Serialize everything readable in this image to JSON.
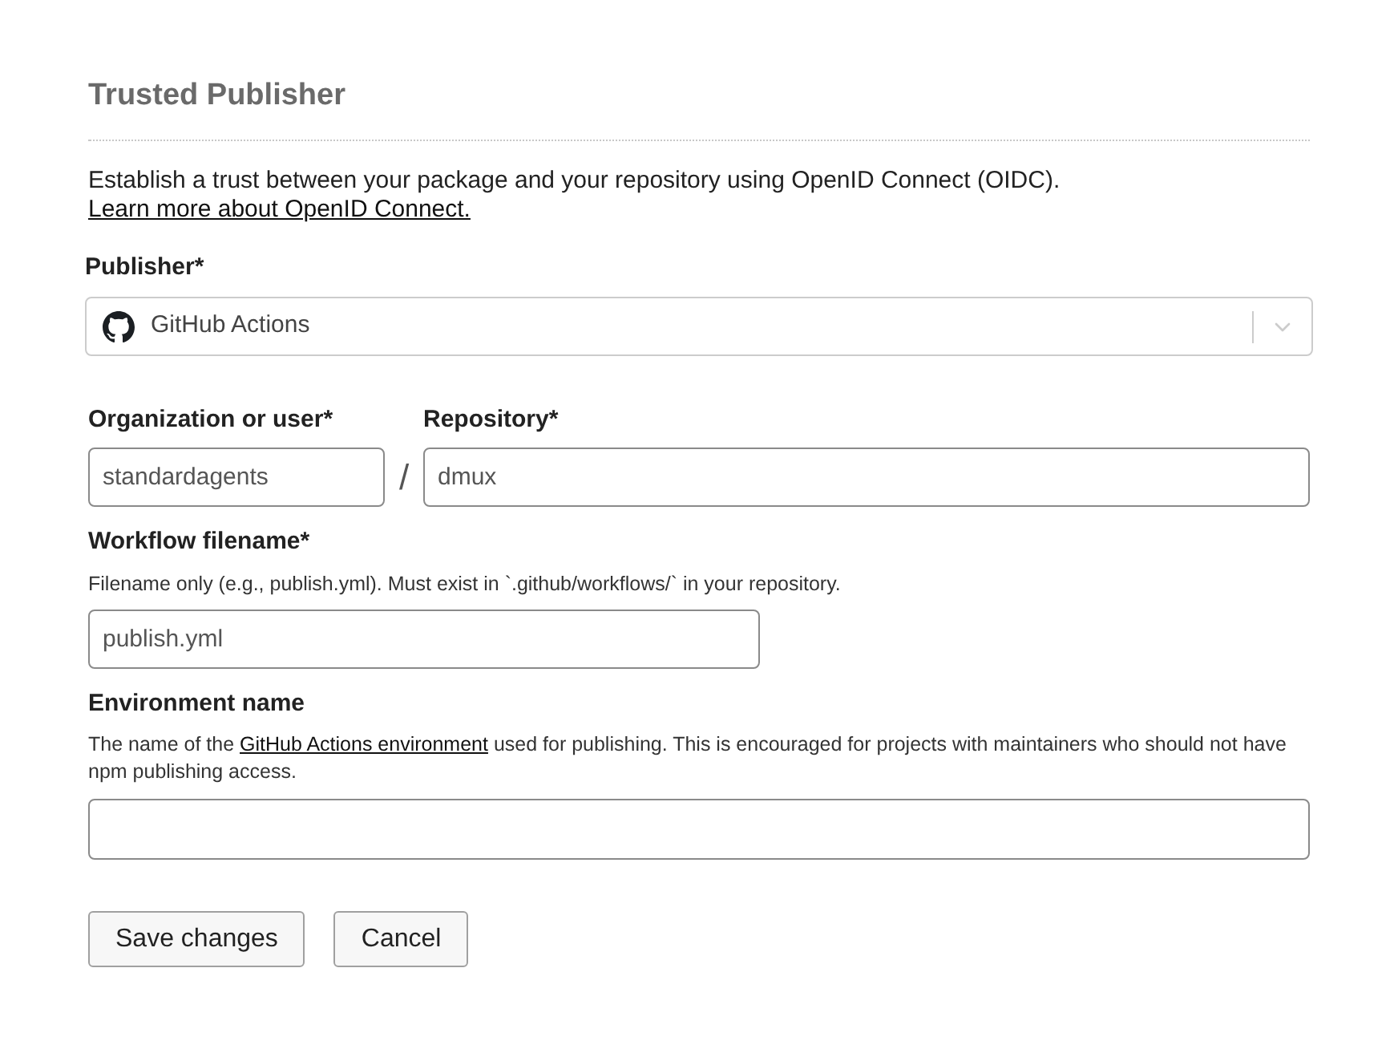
{
  "section": {
    "title": "Trusted Publisher",
    "description": "Establish a trust between your package and your repository using OpenID Connect (OIDC).",
    "link": "Learn more about OpenID Connect."
  },
  "publisher": {
    "label": "Publisher*",
    "value": "GitHub Actions"
  },
  "repository_row": {
    "owner": {
      "label": "Organization or user*",
      "value": "standardagents"
    },
    "separator": "/",
    "repository": {
      "label": "Repository*",
      "value": "dmux"
    }
  },
  "workflow": {
    "label": "Workflow filename*",
    "hint": "Filename only (e.g., publish.yml). Must exist in `.github/workflows/` in your repository.",
    "value": "publish.yml"
  },
  "environment": {
    "label": "Environment name",
    "hint_before": "The name of the ",
    "hint_link": "GitHub Actions environment",
    "hint_after": " used for publishing. This is encouraged for projects with maintainers who should not have npm publishing access."
  },
  "buttons": [
    {
      "label": "Save changes"
    },
    {
      "label": "Cancel"
    }
  ]
}
